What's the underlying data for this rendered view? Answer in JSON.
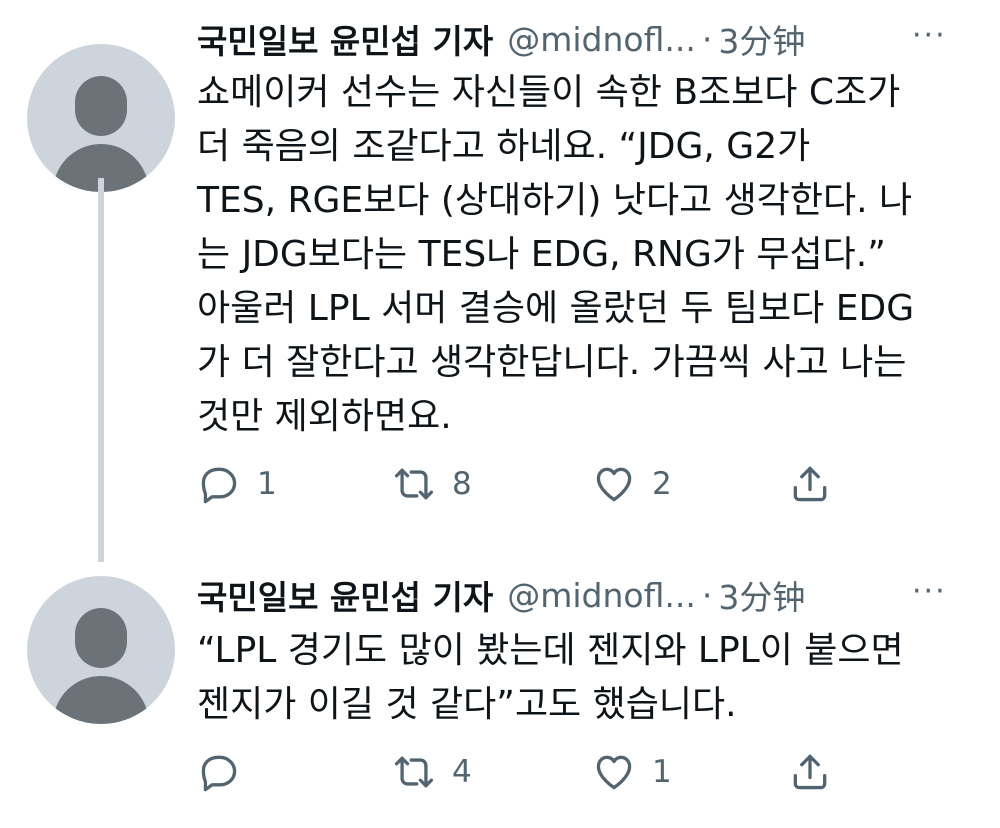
{
  "tweets": [
    {
      "author": "국민일보 윤민섭 기자",
      "handle": "@midnofl...",
      "separator": "·",
      "time": "3分钟",
      "more": "···",
      "text": "쇼메이커 선수는 자신들이 속한 B조보다 C조가\n더 죽음의 조같다고 하네요.  “JDG, G2가\nTES, RGE보다 (상대하기) 낫다고 생각한다. 나\n는 JDG보다는 TES나 EDG, RNG가 무섭다.”\n아울러 LPL 서머 결승에 올랐던 두 팀보다 EDG\n가 더 잘한다고 생각한답니다. 가끔씩 사고 나는\n것만 제외하면요.",
      "replies": "1",
      "retweets": "8",
      "likes": "2"
    },
    {
      "author": "국민일보 윤민섭 기자",
      "handle": "@midnofl...",
      "separator": "·",
      "time": "3分钟",
      "more": "···",
      "text": "“LPL 경기도 많이 봤는데 젠지와 LPL이 붙으면\n젠지가 이길 것 같다”고도 했습니다.",
      "replies": "",
      "retweets": "4",
      "likes": "1"
    }
  ],
  "icons": {
    "reply": "reply-icon",
    "retweet": "retweet-icon",
    "like": "heart-icon",
    "share": "share-icon",
    "avatar": "default-avatar-icon"
  },
  "colors": {
    "text": "#0f1419",
    "secondary": "#536471",
    "avatar_bg": "#cdd4dc",
    "avatar_fg": "#6b7379"
  }
}
